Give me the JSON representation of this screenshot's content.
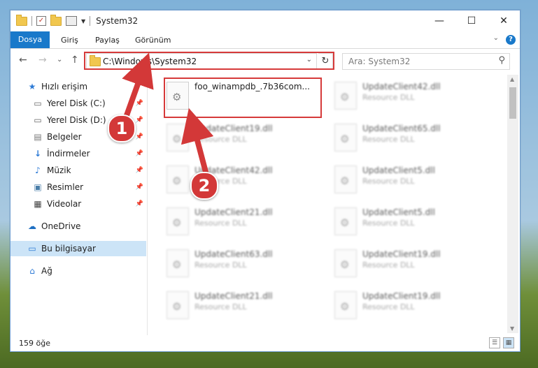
{
  "window": {
    "title": "System32",
    "controls": {
      "minimize": "—",
      "maximize": "☐",
      "close": "✕"
    }
  },
  "ribbon": {
    "tabs": [
      "Dosya",
      "Giriş",
      "Paylaş",
      "Görünüm"
    ],
    "help": "?"
  },
  "navigation": {
    "back": "←",
    "forward": "→",
    "recent": "⌄",
    "up": "↑",
    "address": "C:\\Windows\\System32",
    "refresh": "↻",
    "search_placeholder": "Ara: System32"
  },
  "sidebar": {
    "items": [
      {
        "label": "Hızlı erişim",
        "icon": "star-icon"
      },
      {
        "label": "Yerel Disk (C:)",
        "icon": "drive-icon",
        "pinned": true
      },
      {
        "label": "Yerel Disk (D:)",
        "icon": "drive-icon",
        "pinned": true
      },
      {
        "label": "Belgeler",
        "icon": "documents-icon",
        "pinned": true
      },
      {
        "label": "İndirmeler",
        "icon": "download-icon",
        "pinned": true
      },
      {
        "label": "Müzik",
        "icon": "music-icon",
        "pinned": true
      },
      {
        "label": "Resimler",
        "icon": "pictures-icon",
        "pinned": true
      },
      {
        "label": "Videolar",
        "icon": "video-icon",
        "pinned": true
      },
      {
        "label": "OneDrive",
        "icon": "cloud-icon"
      },
      {
        "label": "Bu bilgisayar",
        "icon": "computer-icon",
        "selected": true
      },
      {
        "label": "Ağ",
        "icon": "network-icon"
      }
    ]
  },
  "files": [
    {
      "name": "foo_winampdb_.7b36com...",
      "type": "",
      "highlighted": true
    },
    {
      "name": "UpdateClient42.dll",
      "type": "Resource DLL"
    },
    {
      "name": "UpdateClient19.dll",
      "type": "Resource DLL"
    },
    {
      "name": "UpdateClient65.dll",
      "type": "Resource DLL"
    },
    {
      "name": "UpdateClient42.dll",
      "type": "Resource DLL"
    },
    {
      "name": "UpdateClient5.dll",
      "type": "Resource DLL"
    },
    {
      "name": "UpdateClient21.dll",
      "type": "Resource DLL"
    },
    {
      "name": "UpdateClient5.dll",
      "type": "Resource DLL"
    },
    {
      "name": "UpdateClient63.dll",
      "type": "Resource DLL"
    },
    {
      "name": "UpdateClient19.dll",
      "type": "Resource DLL"
    },
    {
      "name": "UpdateClient21.dll",
      "type": "Resource DLL"
    },
    {
      "name": "UpdateClient19.dll",
      "type": "Resource DLL"
    }
  ],
  "status": {
    "count": "159 öğe"
  },
  "annotations": {
    "step1": "1",
    "step2": "2",
    "color": "#d33838"
  }
}
